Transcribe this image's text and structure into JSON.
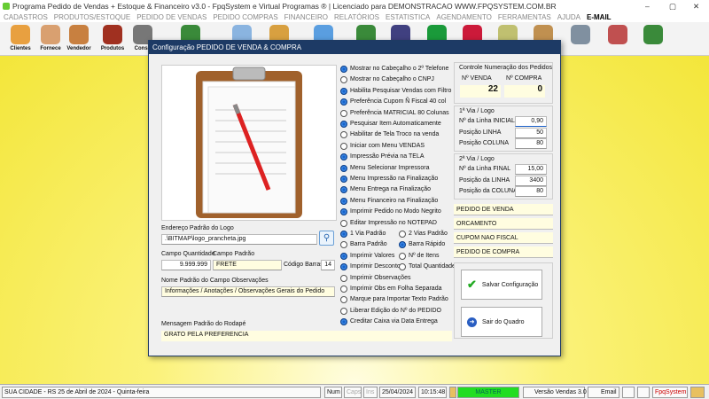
{
  "window": {
    "title": "Programa Pedido de Vendas + Estoque & Financeiro v3.0 - FpqSystem e Virtual Programas ® | Licenciado para  DEMONSTRACAO WWW.FPQSYSTEM.COM.BR",
    "minimize": "–",
    "maximize": "▢",
    "close": "✕"
  },
  "menu": [
    "CADASTROS",
    "PRODUTOS/ESTOQUE",
    "PEDIDO DE VENDAS",
    "PEDIDO COMPRAS",
    "FINANCEIRO",
    "RELATÓRIOS",
    "ESTATISTICA",
    "AGENDAMENTO",
    "FERRAMENTAS",
    "AJUDA",
    "E-MAIL"
  ],
  "toolbar": [
    "Clientes",
    "Fornece",
    "Vendedor",
    "Produtos",
    "Consu"
  ],
  "dialog": {
    "title": "Configuração PEDIDO DE VENDA & COMPRA",
    "logo_label": "Endereço Padrão do Logo",
    "logo_path": ".\\BITMAP\\logo_prancheta.jpg",
    "qty_label": "Campo Quantidade",
    "qty_value": "9.999.999",
    "default_label": "Campo Padrão",
    "default_value": "FRETE",
    "barcode_label": "Código Barras:",
    "barcode_value": "14",
    "obs_label": "Nome Padrão do Campo Observações",
    "obs_value": "Informações / Anotações / Observações Gerais do Pedido",
    "footer_label": "Mensagem Padrão do Rodapé",
    "footer_value": "GRATO PELA PREFERENCIA",
    "options": [
      {
        "label": "Mostrar no Cabeçalho o 2º  Telefone",
        "on": true
      },
      {
        "label": "Mostrar no Cabeçalho o CNPJ",
        "on": false
      },
      {
        "label": "Habilita Pesquisar Vendas com Filtro",
        "on": true
      },
      {
        "label": "Preferência Cupom Ñ Fiscal 40 col",
        "on": true
      },
      {
        "label": "Preferência MATRICIAL 80 Colunas",
        "on": false
      },
      {
        "label": "Pesquisar Item Automaticamente",
        "on": true
      },
      {
        "label": "Habilitar de Tela Troco na venda",
        "on": false
      },
      {
        "label": "Iniciar com Menu VENDAS",
        "on": false
      },
      {
        "label": "Impressão Prévia na TELA",
        "on": true
      },
      {
        "label": "Menu Selecionar Impressora",
        "on": true
      },
      {
        "label": "Menu Impressão na Finalização",
        "on": true
      },
      {
        "label": "Menu Entrega na Finalização",
        "on": true
      },
      {
        "label": "Menu Financeiro na Finalização",
        "on": true
      },
      {
        "label": "Imprimir Pedido no Modo Negrito",
        "on": true
      },
      {
        "label": "Editar Impressão no NOTEPAD",
        "on": false
      }
    ],
    "pairs": [
      [
        {
          "label": "1 Via Padrão",
          "on": true
        },
        {
          "label": "2 Vias Padrão",
          "on": false
        }
      ],
      [
        {
          "label": "Barra Padrão",
          "on": false
        },
        {
          "label": "Barra Rápido",
          "on": true
        }
      ],
      [
        {
          "label": "Imprimir Valores",
          "on": true
        },
        {
          "label": "Nº de Itens",
          "on": false
        }
      ],
      [
        {
          "label": "Imprimir Descontos",
          "on": true
        },
        {
          "label": "Total Quantidade",
          "on": false
        }
      ]
    ],
    "options2": [
      {
        "label": "Imprimir Observações",
        "on": false
      },
      {
        "label": "Imprimir Obs em Folha Separada",
        "on": false
      },
      {
        "label": "Marque para Importar Texto Padrão",
        "on": false
      },
      {
        "label": "Liberar Edição do Nº do PEDIDO",
        "on": false
      },
      {
        "label": "Creditar Caixa via Data Entrega",
        "on": true
      }
    ],
    "numbering": {
      "title": "Controle Numeração dos Pedidos",
      "sale_label": "Nº VENDA",
      "sale": "22",
      "purchase_label": "Nº COMPRA",
      "purchase": "0"
    },
    "via1": {
      "title": "1ª Via / Logo",
      "rows": [
        {
          "label": "Nº da Linha INICIAL",
          "value": "0,90"
        },
        {
          "label": "Posição LINHA",
          "value": "50"
        },
        {
          "label": "Posição COLUNA",
          "value": "80"
        }
      ]
    },
    "via2": {
      "title": "2ª Via / Logo",
      "rows": [
        {
          "label": "Nº da Linha FINAL",
          "value": "15,00"
        },
        {
          "label": "Posição da LINHA",
          "value": "3400"
        },
        {
          "label": "Posição da COLUNA",
          "value": "80"
        }
      ]
    },
    "doc_titles": [
      "PEDIDO DE VENDA",
      "ORCAMENTO",
      "CUPOM NAO FISCAL",
      "PEDIDO DE COMPRA"
    ],
    "save": "Salvar Configuração",
    "exit": "Sair do Quadro"
  },
  "status": {
    "city": "SUA CIDADE - RS 25 de Abril de 2024 - Quinta-feira",
    "num": "Num",
    "caps": "Caps",
    "ins": "Ins",
    "date": "25/04/2024",
    "time": "10:15:48",
    "user": "MASTER",
    "version": "Versão Vendas 3.0",
    "email": "Email",
    "brand": "FpqSystem"
  },
  "colors": {
    "dialog_title": "#1d3a65",
    "radio_on": "#1763c9",
    "master": "#22dd22",
    "brand": "#cc0000"
  }
}
